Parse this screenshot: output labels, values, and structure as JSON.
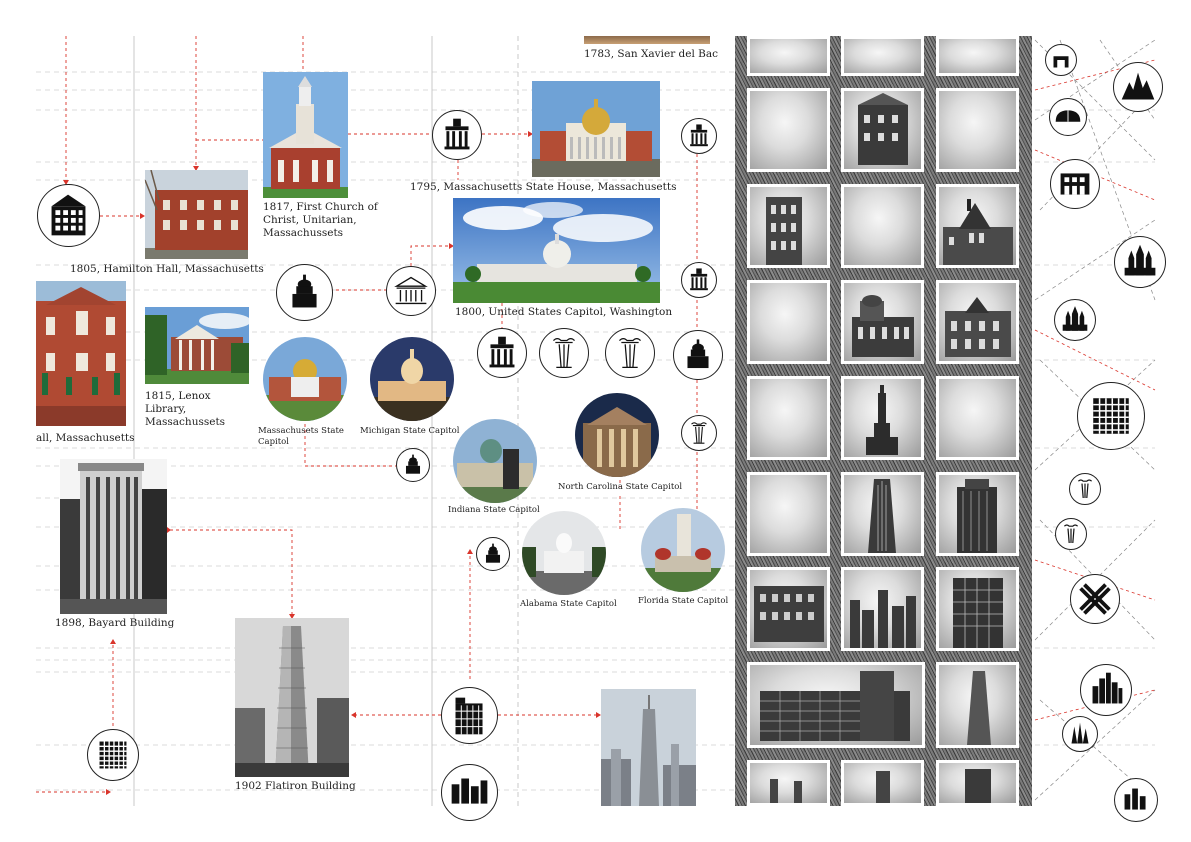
{
  "captions": {
    "san_xavier": "1783, San Xavier del Bac",
    "first_church": "1817, First Church of Christ, Unitarian, Massachussets",
    "mass_state_house": "1795, Massachusetts State House, Massachusetts",
    "hamilton_hall": "1805, Hamilton Hall, Massachusetts",
    "us_capitol": "1800, United States Capitol, Washington",
    "old_hall": "all, Massachusetts",
    "lenox_library": "1815, Lenox Library, Massachussets",
    "mass_capitol": "Massachusets State Capitol",
    "michigan_capitol": "Michigan State Capitol",
    "indiana_capitol": "Indiana State Capitol",
    "nc_capitol": "North Carolina State Capitol",
    "alabama_capitol": "Alabama State Capitol",
    "florida_capitol": "Florida State Capitol",
    "bayard_building": "1898, Bayard Building",
    "flatiron_building": "1902 Flatiron Building"
  },
  "icons": [
    "warehouse-icon",
    "column-portico-icon",
    "column-portico-icon",
    "dome-building-icon",
    "temple-icon",
    "column-portico-icon",
    "ionic-column-icon",
    "ionic-column-icon",
    "dome-building-icon",
    "ionic-column-icon",
    "dome-building-icon",
    "dome-building-icon",
    "grid-tower-icon",
    "setback-tower-icon",
    "skyline-icon"
  ],
  "colors": {
    "guide_red": "#d9342b",
    "guide_grey": "#c8c8c8",
    "icon_black": "#111111"
  }
}
